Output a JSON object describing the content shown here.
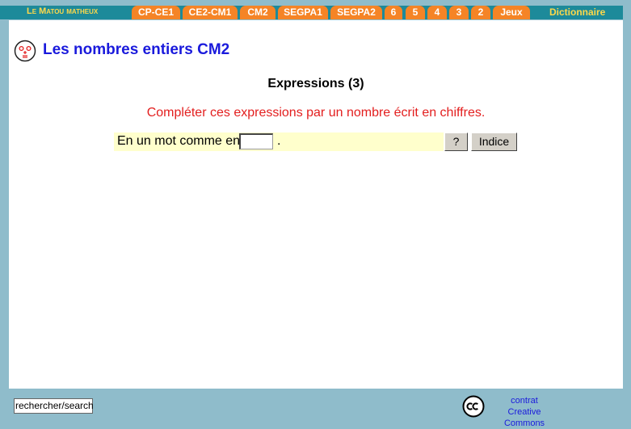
{
  "nav": {
    "brand": "Le Matou matheux",
    "tabs": [
      "CP-CE1",
      "CE2-CM1",
      "CM2",
      "SEGPA1",
      "SEGPA2",
      "6",
      "5",
      "4",
      "3",
      "2",
      "Jeux"
    ],
    "dictionary": "Dictionnaire"
  },
  "page": {
    "title": "Les nombres entiers CM2",
    "subtitle": "Expressions (3)",
    "instruction": "Compléter ces expressions par un nombre écrit en chiffres."
  },
  "exercise": {
    "prompt": "En un mot comme en",
    "answer_value": "",
    "period": ".",
    "help_button": "?",
    "hint_button": "Indice"
  },
  "footer": {
    "search_value": "rechercher/search",
    "cc_line1": "contrat",
    "cc_line2": "Creative Commons"
  },
  "colors": {
    "background": "#8fbccb",
    "nav_bar": "#1d8a9a",
    "tab": "#f58426",
    "brand_text": "#ffd94a",
    "title": "#1a1adc",
    "instruction": "#e31e1e",
    "exercise_row": "#ffffcc"
  },
  "icons": {
    "logo": "cat-face-icon",
    "license": "creative-commons-icon"
  }
}
